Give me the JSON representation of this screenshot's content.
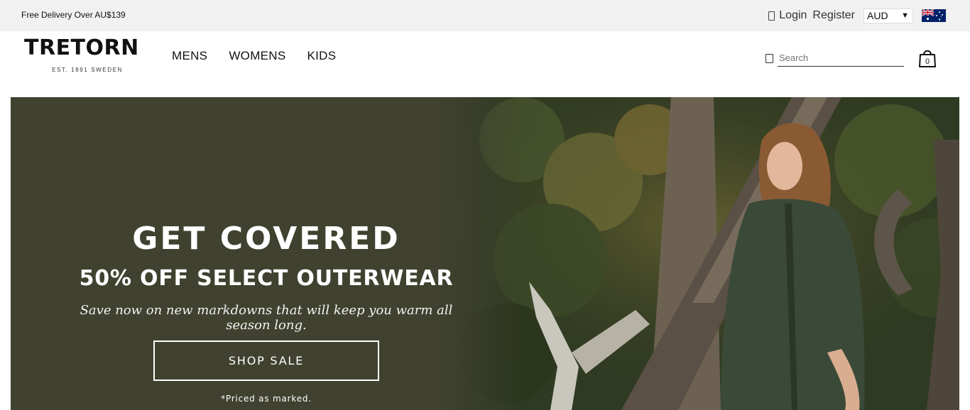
{
  "topbar": {
    "promo": "Free Delivery Over AU$139",
    "login_label": "Login",
    "register_label": "Register",
    "currency": "AUD",
    "flag": "australia-flag"
  },
  "header": {
    "logo_word": "TRETORN",
    "logo_tagline": "EST. 1891 SWEDEN",
    "nav": [
      "MENS",
      "WOMENS",
      "KIDS"
    ],
    "search_placeholder": "Search",
    "cart_count": "0"
  },
  "hero": {
    "title": "GET COVERED",
    "subtitle": "50% OFF SELECT OUTERWEAR",
    "description": "Save now on new markdowns that will keep you warm all season long.",
    "button_label": "SHOP SALE",
    "note": "*Priced as marked.",
    "panel_color": "#40412f",
    "jacket_color": "#3b4a38"
  }
}
